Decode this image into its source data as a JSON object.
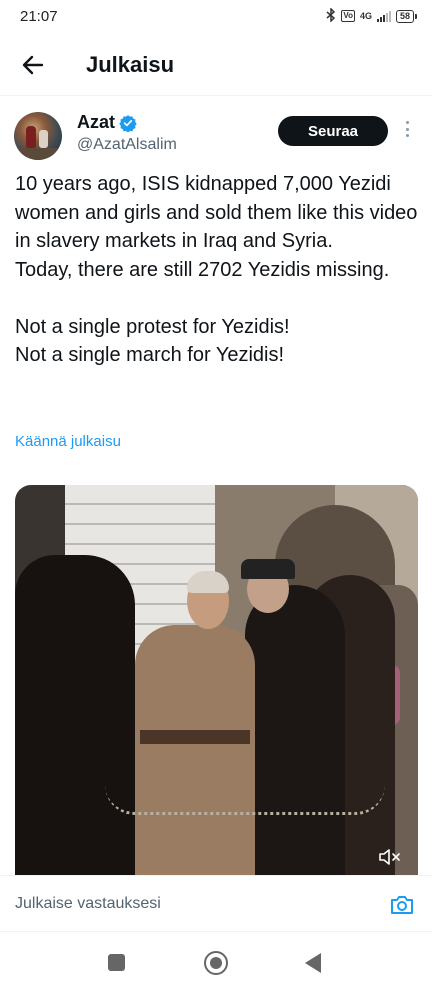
{
  "status_bar": {
    "time": "21:07",
    "network_label": "4G",
    "volte_label": "Vo",
    "battery_level": "58",
    "icons": [
      "bluetooth-icon",
      "volte-icon",
      "signal-icon",
      "battery-icon"
    ]
  },
  "header": {
    "back_icon": "arrow-left-icon",
    "title": "Julkaisu"
  },
  "author": {
    "display_name": "Azat",
    "handle": "@AzatAlsalim",
    "verified": true,
    "follow_label": "Seuraa",
    "more_icon": "more-vertical-icon"
  },
  "post": {
    "text": "10 years ago, ISIS kidnapped 7,000 Yezidi women and girls and sold them like this video in slavery markets in Iraq and Syria.\nToday, there are still 2702 Yezidis missing.\n\nNot a single protest for Yezidis!\nNot a single march for Yezidis!",
    "translate_label": "Käännä julkaisu",
    "media_type": "video",
    "media_muted_icon": "volume-muted-icon"
  },
  "reply": {
    "placeholder": "Julkaise vastauksesi",
    "camera_icon": "camera-icon"
  },
  "nav": {
    "items": [
      "recents-square-icon",
      "home-circle-icon",
      "back-triangle-icon"
    ]
  },
  "colors": {
    "accent": "#1d9bf0",
    "text_primary": "#0f1419",
    "text_secondary": "#536471",
    "follow_button_bg": "#0f1419"
  }
}
